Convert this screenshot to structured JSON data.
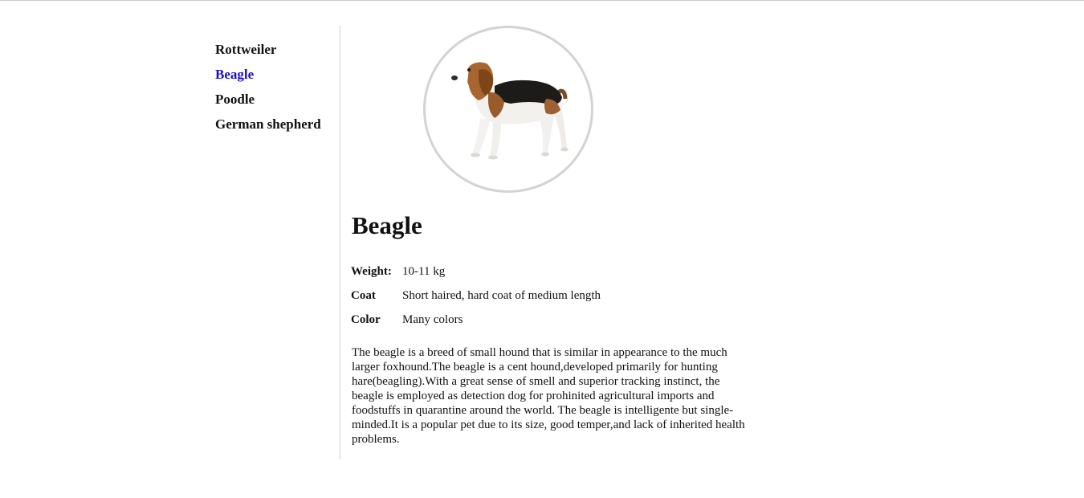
{
  "sidebar": {
    "items": [
      {
        "label": "Rottweiler",
        "active": false
      },
      {
        "label": "Beagle",
        "active": true
      },
      {
        "label": "Poodle",
        "active": false
      },
      {
        "label": "German shepherd",
        "active": false
      }
    ]
  },
  "breed": {
    "image_icon": "beagle-photo",
    "title": "Beagle",
    "specs": [
      {
        "label": "Weight:",
        "value": "10-11 kg"
      },
      {
        "label": "Coat",
        "value": "Short haired, hard coat of medium length"
      },
      {
        "label": "Color",
        "value": "Many colors"
      }
    ],
    "description": "The beagle is a breed of small hound that is similar in appearance to the much larger foxhound.The beagle is a cent hound,developed primarily for hunting hare(beagling).With a great sense of smell and superior tracking instinct, the beagle is employed as detection dog for prohinited agricultural imports and foodstuffs in quarantine around the world. The beagle is intelligente but single-minded.It is a popular pet due to its size, good temper,and lack of inherited health problems."
  },
  "colors": {
    "active_link": "#1a0dcc",
    "text": "#111111",
    "divider": "#cfcfcf",
    "circle_border": "#d3d3d3"
  }
}
